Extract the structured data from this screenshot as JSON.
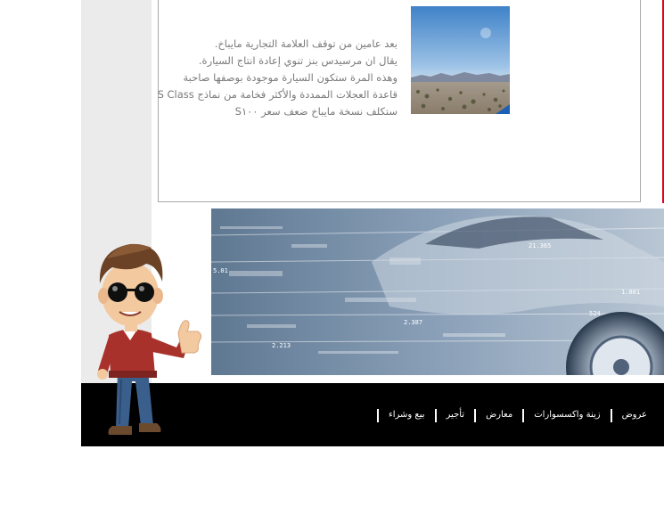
{
  "article": {
    "lines": [
      "بعد عامين من توقف العلامة التجارية مايباخ.",
      "يقال ان مرسيدس بنز تنوي إعادة انتاج السيارة.",
      "وهذه المرة ستكون السيارة موجودة بوصفها صاحبة",
      "قاعدة العجلات الممددة والأكثر فخامة من نماذج S Class",
      "ستكلف نسخة مايباخ ضعف سعر S۱۰۰"
    ]
  },
  "banner": {
    "hud_labels": [
      "21.365",
      "2.387",
      "2.213",
      "5.01",
      "524",
      "1.001"
    ]
  },
  "nav": {
    "items": [
      "بيع وشراء",
      "تأجير",
      "معارض",
      "زينة واكسسوارات",
      "عروض"
    ]
  },
  "colors": {
    "accent": "#e2001a",
    "nav_bg": "#000000",
    "sidebar_bg": "#ebebeb",
    "text": "#7a7a7a"
  }
}
